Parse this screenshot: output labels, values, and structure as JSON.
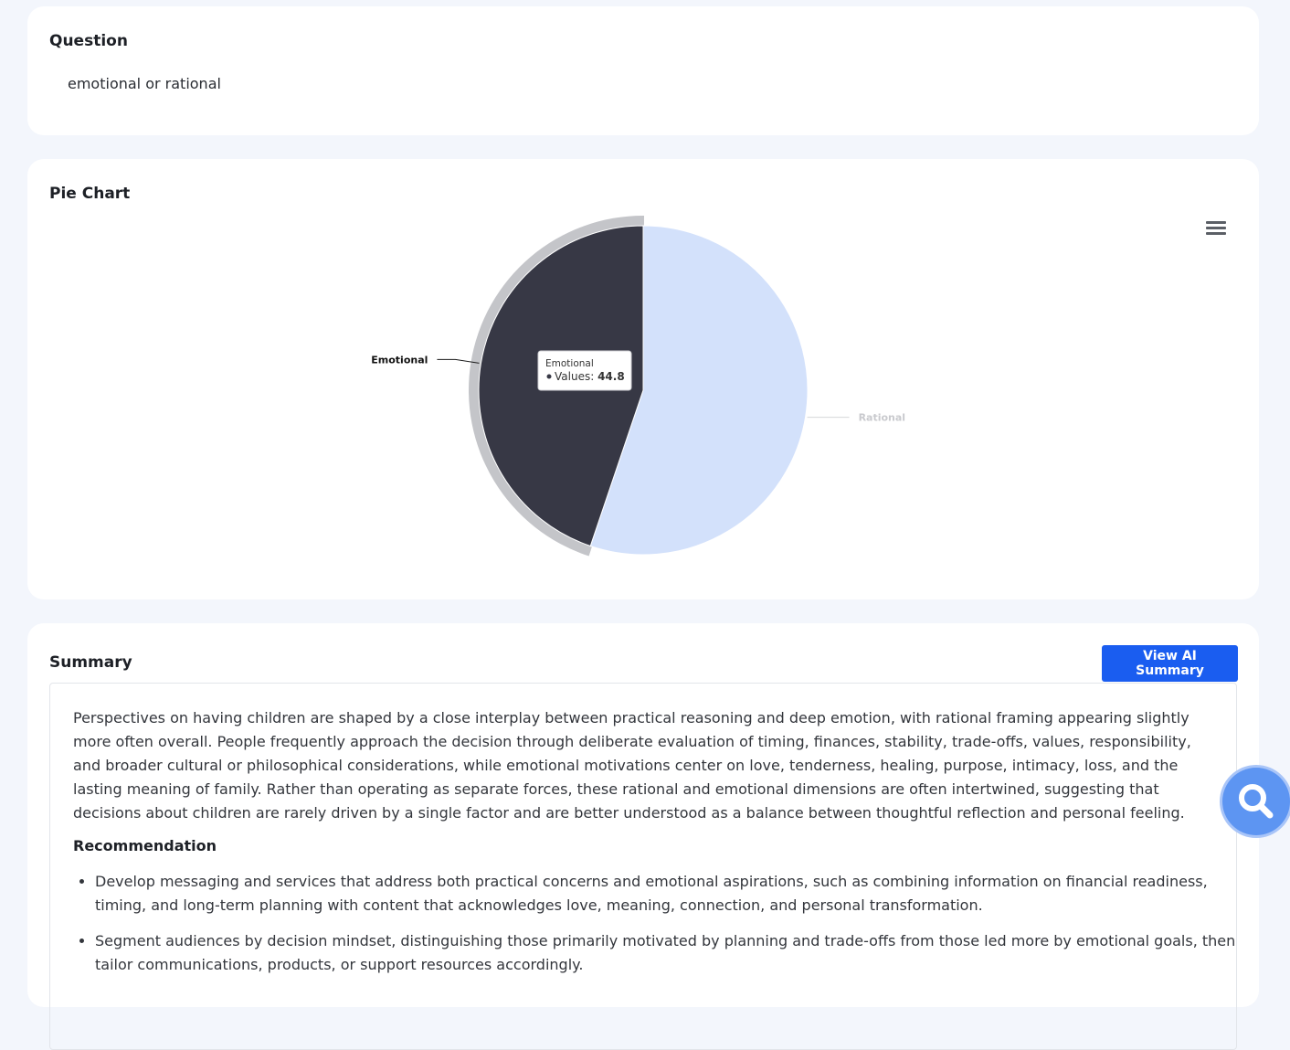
{
  "question": {
    "title": "Question",
    "text": "emotional or rational"
  },
  "chart_card": {
    "title": "Pie Chart",
    "menu_icon": "hamburger-menu-icon"
  },
  "chart_data": {
    "type": "pie",
    "slices": [
      {
        "label": "Emotional",
        "value": 44.8,
        "color": "#373845"
      },
      {
        "label": "Rational",
        "value": 55.2,
        "color": "#d3e1fb"
      }
    ],
    "tooltip": {
      "category": "Emotional",
      "series_label": "Values:",
      "value": "44.8"
    },
    "hovered": "Emotional"
  },
  "summary": {
    "title": "Summary",
    "ai_button": "View AI Summary",
    "text": "Perspectives on having children are shaped by a close interplay between practical reasoning and deep emotion, with rational framing appearing slightly more often overall. People frequently approach the decision through deliberate evaluation of timing, finances, stability, trade-offs, values, responsibility, and broader cultural or philosophical considerations, while emotional motivations center on love, tenderness, healing, purpose, intimacy, loss, and the lasting meaning of family. Rather than operating as separate forces, these rational and emotional dimensions are often intertwined, suggesting that decisions about children are rarely driven by a single factor and are better understood as a balance between thoughtful reflection and personal feeling.",
    "recommendation_title": "Recommendation",
    "recommendations": [
      "Develop messaging and services that address both practical concerns and emotional aspirations, such as combining information on financial readiness, timing, and long-term planning with content that acknowledges love, meaning, connection, and personal transformation.",
      "Segment audiences by decision mindset, distinguishing those primarily motivated by planning and trade-offs from those led more by emotional goals, then tailor communications, products, or support resources accordingly."
    ]
  },
  "fab": {
    "icon": "search-icon"
  }
}
